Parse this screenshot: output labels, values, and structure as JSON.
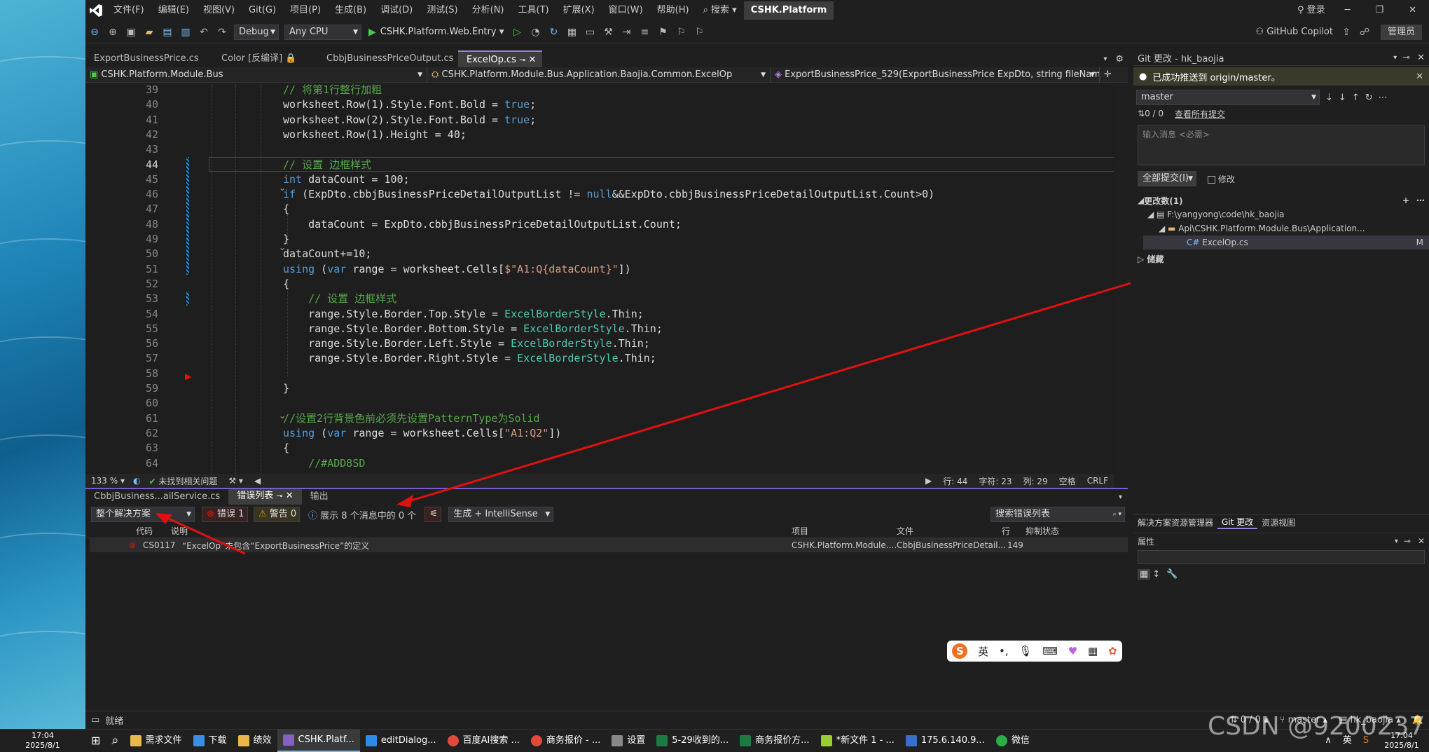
{
  "menu": {
    "items": [
      "文件(F)",
      "编辑(E)",
      "视图(V)",
      "Git(G)",
      "项目(P)",
      "生成(B)",
      "调试(D)",
      "测试(S)",
      "分析(N)",
      "工具(T)",
      "扩展(X)",
      "窗口(W)",
      "帮助(H)"
    ],
    "search": "搜索",
    "solution_name": "CSHK.Platform",
    "login": "登录"
  },
  "toolbar": {
    "config": "Debug",
    "platform": "Any CPU",
    "run_target": "CSHK.Platform.Web.Entry",
    "copilot": "GitHub Copilot",
    "admin": "管理员"
  },
  "doc_tabs": [
    "ExportBusinessPrice.cs",
    "Color [反编译]",
    "CbbjBusinessPriceOutput.cs",
    "ExcelOp.cs"
  ],
  "nav": {
    "project": "CSHK.Platform.Module.Bus",
    "type": "CSHK.Platform.Module.Bus.Application.Baojia.Common.ExcelOp",
    "member": "ExportBusinessPrice_529(ExportBusinessPrice ExpDto, string fileName)"
  },
  "code_lines": [
    {
      "n": "39",
      "t": "// 将第1行整行加粗"
    },
    {
      "n": "40",
      "t": "worksheet.Row(1).Style.Font.Bold = true;"
    },
    {
      "n": "41",
      "t": "worksheet.Row(2).Style.Font.Bold = true;"
    },
    {
      "n": "42",
      "t": "worksheet.Row(1).Height = 40;"
    },
    {
      "n": "43",
      "t": ""
    },
    {
      "n": "44",
      "t": "// 设置 边框样式"
    },
    {
      "n": "45",
      "t": "int dataCount = 100;"
    },
    {
      "n": "46",
      "t": "if (ExpDto.cbbjBusinessPriceDetailOutputList != null&&ExpDto.cbbjBusinessPriceDetailOutputList.Count>0)"
    },
    {
      "n": "47",
      "t": "{"
    },
    {
      "n": "48",
      "t": "    dataCount = ExpDto.cbbjBusinessPriceDetailOutputList.Count;"
    },
    {
      "n": "49",
      "t": "}"
    },
    {
      "n": "50",
      "t": "dataCount+=10;"
    },
    {
      "n": "51",
      "t": "using (var range = worksheet.Cells[$\"A1:Q{dataCount}\"])"
    },
    {
      "n": "52",
      "t": "{"
    },
    {
      "n": "53",
      "t": "    // 设置 边框样式"
    },
    {
      "n": "54",
      "t": "    range.Style.Border.Top.Style = ExcelBorderStyle.Thin;"
    },
    {
      "n": "55",
      "t": "    range.Style.Border.Bottom.Style = ExcelBorderStyle.Thin;"
    },
    {
      "n": "56",
      "t": "    range.Style.Border.Left.Style = ExcelBorderStyle.Thin;"
    },
    {
      "n": "57",
      "t": "    range.Style.Border.Right.Style = ExcelBorderStyle.Thin;"
    },
    {
      "n": "58",
      "t": ""
    },
    {
      "n": "59",
      "t": "}"
    },
    {
      "n": "60",
      "t": ""
    },
    {
      "n": "61",
      "t": "//设置2行背景色前必须先设置PatternType为Solid"
    },
    {
      "n": "62",
      "t": "using (var range = worksheet.Cells[\"A1:Q2\"])"
    },
    {
      "n": "63",
      "t": "{"
    },
    {
      "n": "64",
      "t": "    //#ADD8SD"
    }
  ],
  "editor_status": {
    "zoom": "133 %",
    "issues": "未找到相关问题",
    "line": "行: 44",
    "char": "字符: 23",
    "col": "列: 29",
    "ws": "空格",
    "eol": "CRLF"
  },
  "bottom_tabs": [
    "CbbjBusiness...ailService.cs",
    "错误列表",
    "输出"
  ],
  "error_list": {
    "scope": "整个解决方案",
    "errors": "错误 1",
    "warnings": "警告 0",
    "messages": "展示 8 个消息中的 0 个",
    "build": "生成 + IntelliSense",
    "search": "搜索错误列表",
    "headers": [
      "代码",
      "说明",
      "项目",
      "文件",
      "行",
      "抑制状态"
    ],
    "rows": [
      {
        "code": "CS0117",
        "desc": "“ExcelOp”未包含“ExportBusinessPrice”的定义",
        "project": "CSHK.Platform.Module....",
        "file": "CbbjBusinessPriceDetail...",
        "line": "149"
      }
    ]
  },
  "git": {
    "title": "Git 更改 - hk_baojia",
    "pushed": "已成功推送到 origin/master。",
    "branch": "master",
    "counts": "0 / 0",
    "view_all": "查看所有提交",
    "msg_placeholder": "输入消息 <必需>",
    "commit_all": "全部提交(I)",
    "amend": "修改",
    "changes": "更改数(1)",
    "repo_path": "F:\\yangyong\\code\\hk_baojia",
    "folder": "Api\\CSHK.Platform.Module.Bus\\Application...",
    "file": "ExcelOp.cs",
    "file_status": "M",
    "stashes": "储藏",
    "tabs": [
      "解决方案资源管理器",
      "Git 更改",
      "资源视图"
    ],
    "properties": "属性"
  },
  "ime": {
    "lang": "英"
  },
  "statusbar": {
    "ready": "就绪",
    "sync": "0 / 0",
    "branch": "master",
    "repo": "hk_baojia"
  },
  "taskbar": {
    "time": "17:04",
    "date": "2025/8/1",
    "items": [
      "需求文件",
      "下载",
      "绩效",
      "CSHK.Platf...",
      "editDialog...",
      "百度AI搜索 ...",
      "商务报价 - ...",
      "设置",
      "5-29收到的...",
      "商务报价方...",
      "*新文件 1 - ...",
      "175.6.140.9...",
      "微信"
    ],
    "lang": "英",
    "watermark": "CSDN @9200237"
  },
  "colors": {
    "accent": "#7a5ccf",
    "error": "#e51400",
    "warning": "#cca700",
    "active_tab": "#9a7fdd",
    "arrow": "#e01010"
  }
}
